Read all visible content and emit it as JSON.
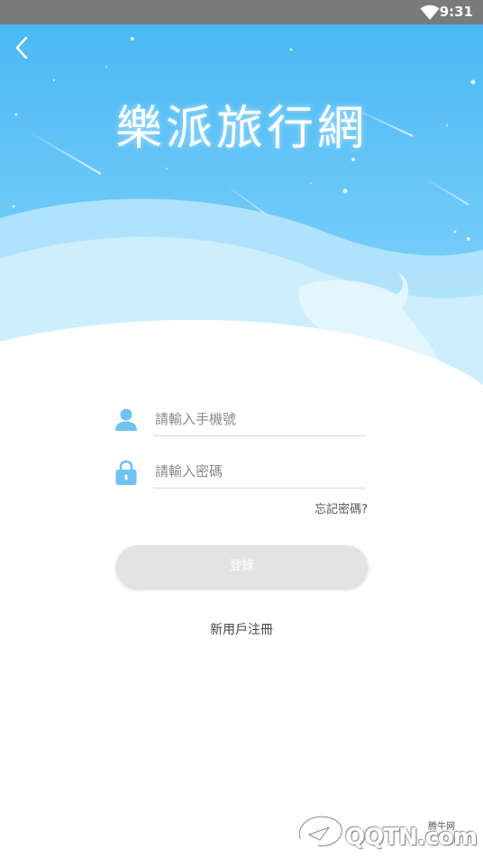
{
  "status_bar": {
    "time": "9:31",
    "wifi_icon": "wifi-icon"
  },
  "header": {
    "back_icon": "chevron-left-icon",
    "title": "樂派旅行網"
  },
  "login_form": {
    "phone": {
      "icon": "user-icon",
      "placeholder": "請輸入手機號",
      "value": ""
    },
    "password": {
      "icon": "lock-icon",
      "placeholder": "請輸入密碼",
      "value": ""
    },
    "forgot_password": "忘記密碼?",
    "login_label": "登錄",
    "register_label": "新用戶注冊"
  },
  "watermark": {
    "text": "QQTN.com",
    "sub": "腾牛网"
  },
  "colors": {
    "sky_top": "#4fbcf5",
    "sky_bottom": "#8ad6fb",
    "icon_blue": "#6ec3f0",
    "button_disabled": "#e3e3e3",
    "status_bar": "#7a7a7a"
  }
}
